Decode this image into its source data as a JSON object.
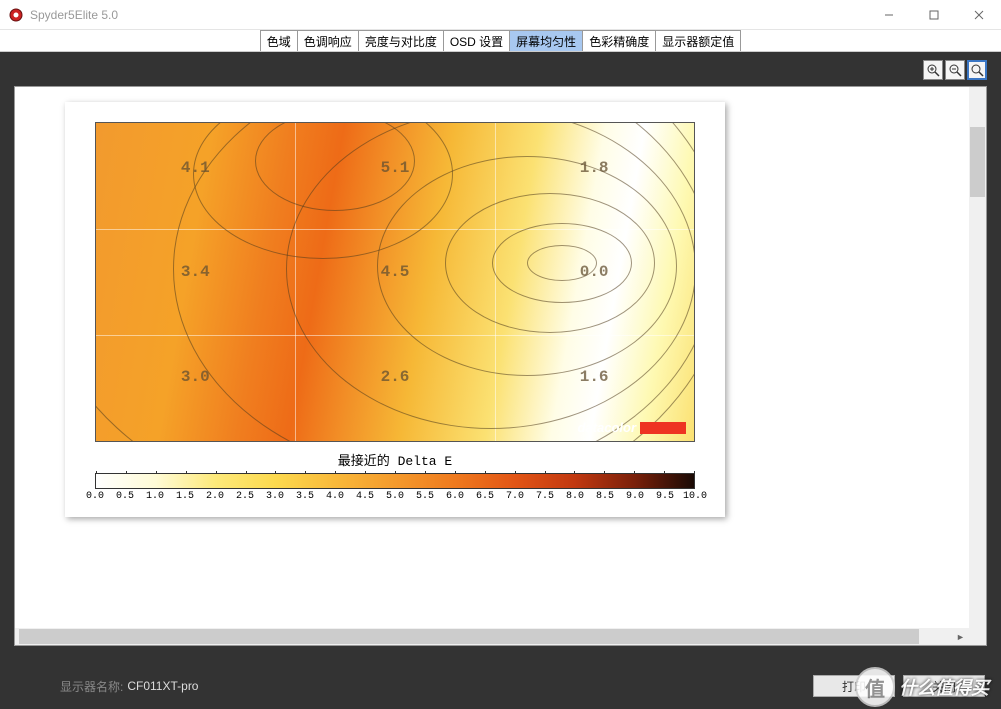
{
  "window": {
    "title": "Spyder5Elite 5.0"
  },
  "tabs": [
    {
      "label": "色域"
    },
    {
      "label": "色调响应"
    },
    {
      "label": "亮度与对比度"
    },
    {
      "label": "OSD 设置"
    },
    {
      "label": "屏幕均匀性",
      "active": true
    },
    {
      "label": "色彩精确度"
    },
    {
      "label": "显示器额定值"
    }
  ],
  "chart_data": {
    "type": "heatmap",
    "title": "最接近的 Delta E",
    "grid": {
      "rows": 3,
      "cols": 3
    },
    "cells": [
      {
        "row": 0,
        "col": 0,
        "value": 4.1
      },
      {
        "row": 0,
        "col": 1,
        "value": 5.1
      },
      {
        "row": 0,
        "col": 2,
        "value": 1.8
      },
      {
        "row": 1,
        "col": 0,
        "value": 3.4
      },
      {
        "row": 1,
        "col": 1,
        "value": 4.5
      },
      {
        "row": 1,
        "col": 2,
        "value": 0.0
      },
      {
        "row": 2,
        "col": 0,
        "value": 3.0
      },
      {
        "row": 2,
        "col": 1,
        "value": 2.6
      },
      {
        "row": 2,
        "col": 2,
        "value": 1.6
      }
    ],
    "colorbar": {
      "min": 0.0,
      "max": 10.0,
      "step": 0.5,
      "ticks": [
        "0.0",
        "0.5",
        "1.0",
        "1.5",
        "2.0",
        "2.5",
        "3.0",
        "3.5",
        "4.0",
        "4.5",
        "5.0",
        "5.5",
        "6.0",
        "6.5",
        "7.0",
        "7.5",
        "8.0",
        "8.5",
        "9.0",
        "9.5",
        "10.0"
      ]
    },
    "brand": "datacolor"
  },
  "footer": {
    "monitor_label": "显示器名称:",
    "monitor_value": "CF011XT-pro",
    "print": "打印",
    "close": "关闭"
  },
  "watermark": {
    "char": "值",
    "text": "什么值得买"
  }
}
